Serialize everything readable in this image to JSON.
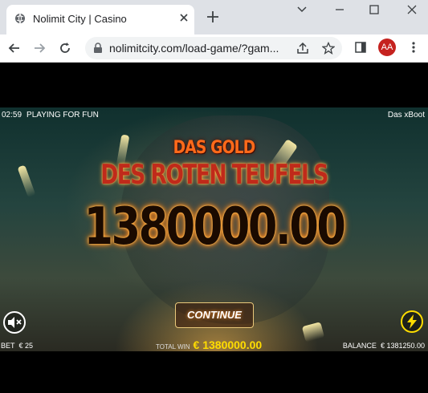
{
  "browser": {
    "tab_title": "Nolimit City | Casino",
    "url": "nolimitcity.com/load-game/?gam...",
    "profile_initials": "AA"
  },
  "game": {
    "timer": "02:59",
    "mode": "PLAYING FOR FUN",
    "feature": "Das xBoot",
    "title_line1": "DAS GOLD",
    "title_line2": "DES ROTEN TEUFELS",
    "win_amount": "1380000.00",
    "continue_label": "CONTINUE",
    "bet_label": "BET",
    "bet_value": "€ 25",
    "total_win_label": "TOTAL WIN",
    "total_win_value": "€ 1380000.00",
    "balance_label": "BALANCE",
    "balance_value": "€ 1381250.00"
  },
  "icons": {
    "sound": "muted-speaker-icon",
    "turbo": "lightning-icon"
  },
  "colors": {
    "accent_yellow": "#ffdd00",
    "title_red": "#c02a1a",
    "title_orange": "#ff6a1a"
  }
}
